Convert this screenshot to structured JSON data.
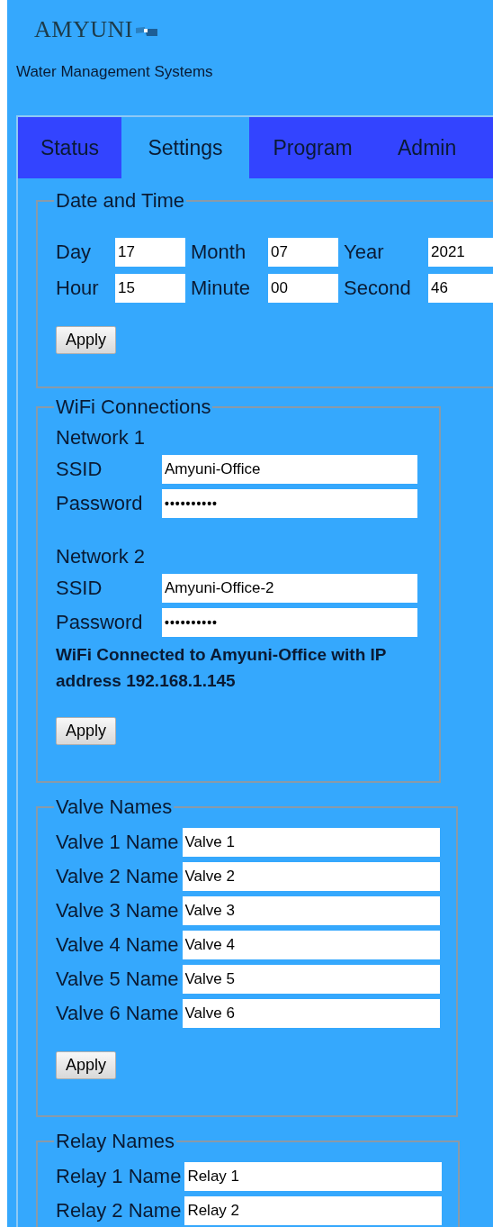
{
  "logo": {
    "text": "AMYUNI"
  },
  "subtitle": "Water Management Systems",
  "tabs": [
    {
      "label": "Status",
      "selected": false
    },
    {
      "label": "Settings",
      "selected": true
    },
    {
      "label": "Program",
      "selected": false
    },
    {
      "label": "Admin",
      "selected": false
    }
  ],
  "date_time": {
    "legend": "Date and Time",
    "fields": [
      {
        "label": "Day",
        "value": "17"
      },
      {
        "label": "Month",
        "value": "07"
      },
      {
        "label": "Year",
        "value": "2021"
      },
      {
        "label": "Hour",
        "value": "15"
      },
      {
        "label": "Minute",
        "value": "00"
      },
      {
        "label": "Second",
        "value": "46"
      }
    ],
    "button": "Apply"
  },
  "wifi": {
    "legend": "WiFi Connections",
    "networks": [
      {
        "title": "Network 1",
        "ssid_label": "SSID",
        "ssid": "Amyuni-Office",
        "password_label": "Password",
        "password": "••••••••••"
      },
      {
        "title": "Network 2",
        "ssid_label": "SSID",
        "ssid": "Amyuni-Office-2",
        "password_label": "Password",
        "password": "••••••••••"
      }
    ],
    "status": "WiFi Connected to Amyuni-Office with IP address 192.168.1.145",
    "button": "Apply"
  },
  "valves": {
    "legend": "Valve Names",
    "rows": [
      {
        "label": "Valve 1 Name",
        "value": "Valve 1"
      },
      {
        "label": "Valve 2 Name",
        "value": "Valve 2"
      },
      {
        "label": "Valve 3 Name",
        "value": "Valve 3"
      },
      {
        "label": "Valve 4 Name",
        "value": "Valve 4"
      },
      {
        "label": "Valve 5 Name",
        "value": "Valve 5"
      },
      {
        "label": "Valve 6 Name",
        "value": "Valve 6"
      }
    ],
    "button": "Apply"
  },
  "relays": {
    "legend": "Relay Names",
    "rows": [
      {
        "label": "Relay 1 Name",
        "value": "Relay 1"
      },
      {
        "label": "Relay 2 Name",
        "value": "Relay 2"
      }
    ]
  }
}
